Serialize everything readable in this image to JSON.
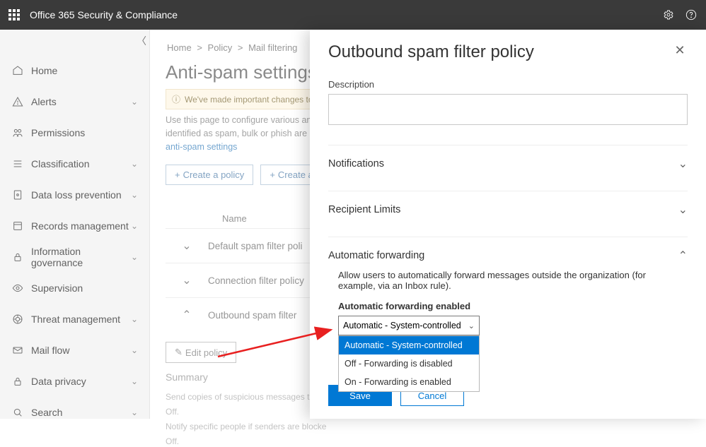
{
  "topbar": {
    "title": "Office 365 Security & Compliance"
  },
  "sidebar": {
    "items": [
      {
        "label": "Home",
        "icon": "home",
        "expandable": false
      },
      {
        "label": "Alerts",
        "icon": "alert",
        "expandable": true
      },
      {
        "label": "Permissions",
        "icon": "perm",
        "expandable": false
      },
      {
        "label": "Classification",
        "icon": "class",
        "expandable": true
      },
      {
        "label": "Data loss prevention",
        "icon": "dlp",
        "expandable": true
      },
      {
        "label": "Records management",
        "icon": "records",
        "expandable": true
      },
      {
        "label": "Information governance",
        "icon": "lock",
        "expandable": true
      },
      {
        "label": "Supervision",
        "icon": "eye",
        "expandable": false
      },
      {
        "label": "Threat management",
        "icon": "threat",
        "expandable": true
      },
      {
        "label": "Mail flow",
        "icon": "mail",
        "expandable": true
      },
      {
        "label": "Data privacy",
        "icon": "lock",
        "expandable": true
      },
      {
        "label": "Search",
        "icon": "search",
        "expandable": true
      }
    ]
  },
  "main": {
    "crumbs": [
      "Home",
      "Policy",
      "Mail filtering"
    ],
    "heading": "Anti-spam settings",
    "banner": "We've made important changes to imp",
    "description1": "Use this page to configure various anti",
    "description2": "identified as spam, bulk or phish are ha",
    "description_link": "anti-spam settings",
    "create_policy": "Create a policy",
    "create_an": "Create an",
    "column_name": "Name",
    "policies": [
      {
        "name": "Default spam filter poli",
        "expanded": false
      },
      {
        "name": "Connection filter policy",
        "expanded": false
      },
      {
        "name": "Outbound spam filter",
        "expanded": true
      }
    ],
    "edit_policy": "Edit policy",
    "summary_title": "Summary",
    "summary_line1": "Send copies of suspicious messages to spe",
    "summary_off": "Off.",
    "summary_line2": "Notify specific people if senders are blocke",
    "summary_off2": "Off."
  },
  "flyout": {
    "title": "Outbound spam filter policy",
    "description_label": "Description",
    "description_value": "",
    "sections": {
      "notifications": "Notifications",
      "recipient_limits": "Recipient Limits",
      "auto_forwarding": "Automatic forwarding"
    },
    "auto_forward": {
      "help": "Allow users to automatically forward messages outside the organization (for example, via an Inbox rule).",
      "label": "Automatic forwarding enabled",
      "selected": "Automatic - System-controlled",
      "options": [
        "Automatic - System-controlled",
        "Off - Forwarding is disabled",
        "On - Forwarding is enabled"
      ]
    },
    "save": "Save",
    "cancel": "Cancel"
  }
}
